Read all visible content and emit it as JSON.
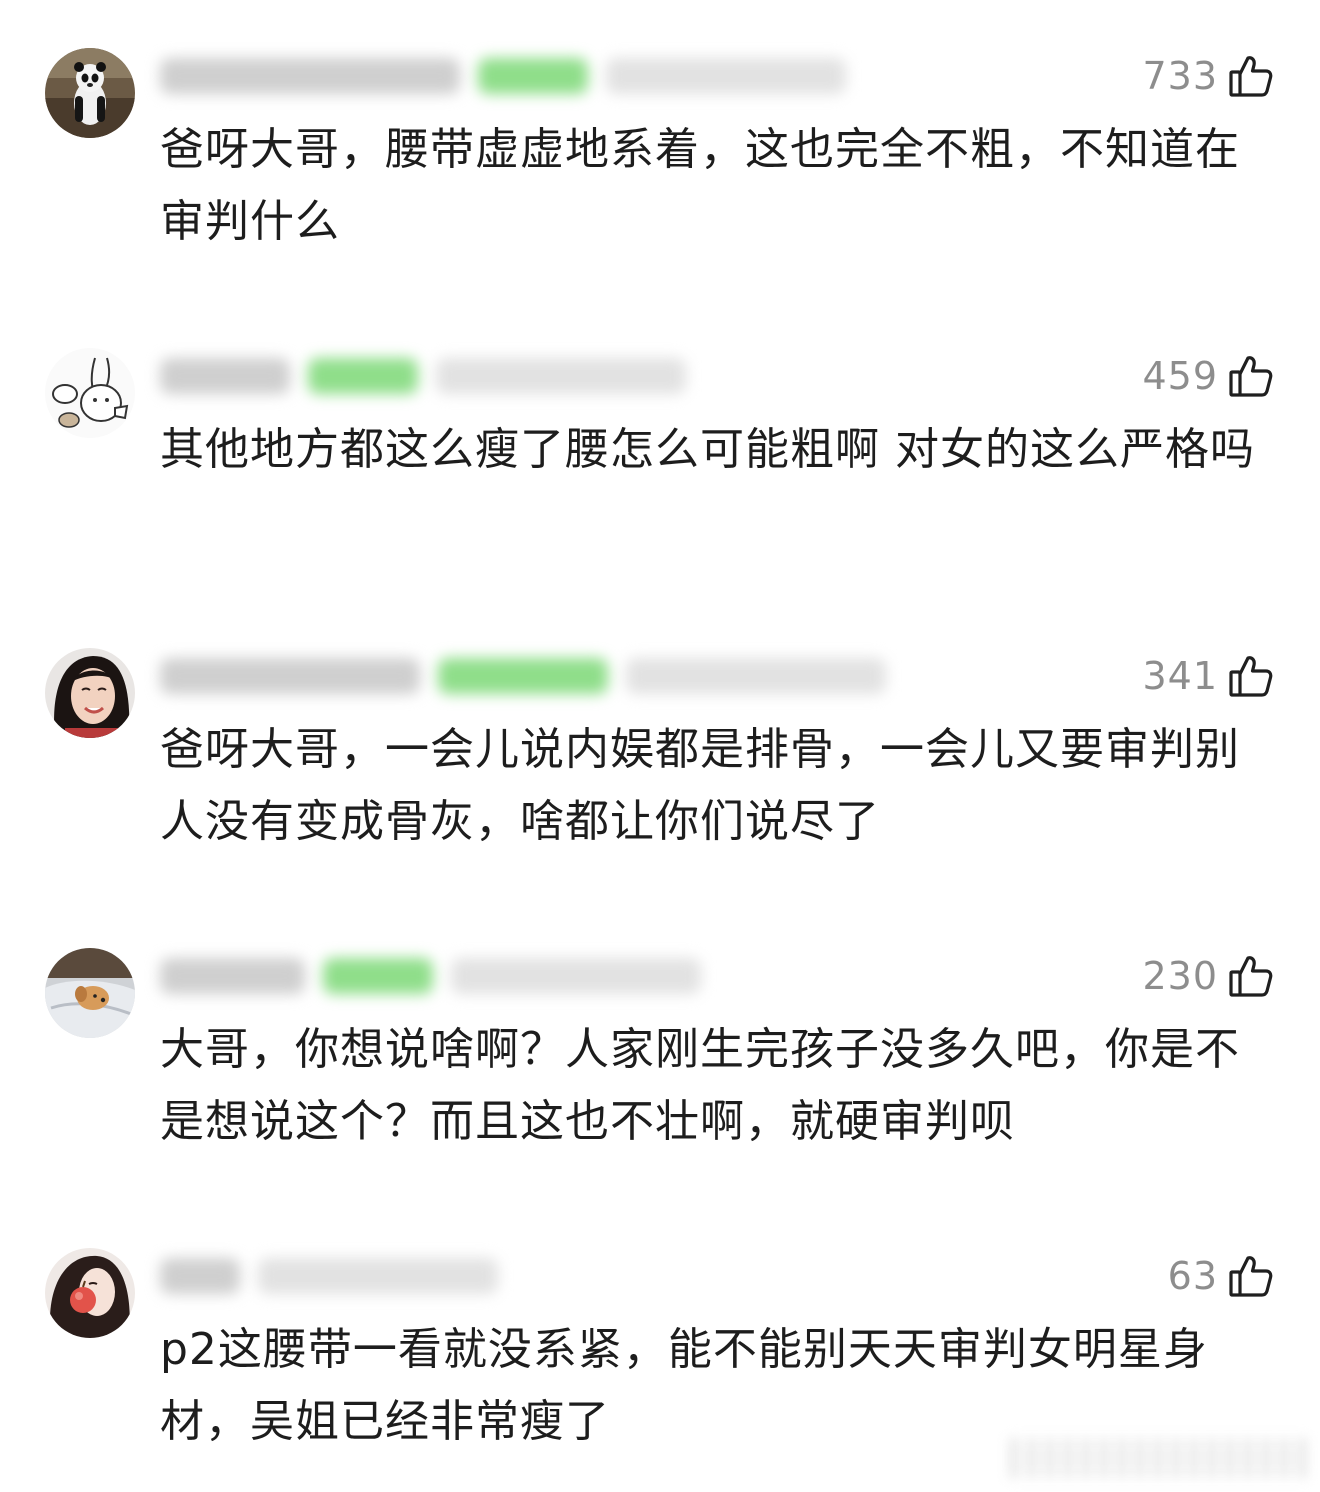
{
  "comments": [
    {
      "likes": "733",
      "text": "爸呀大哥，腰带虚虚地系着，这也完全不粗，不知道在审判什么",
      "avatar_icon": "panda-avatar-icon"
    },
    {
      "likes": "459",
      "text": "其他地方都这么瘦了腰怎么可能粗啊 对女的这么严格吗",
      "avatar_icon": "cartoon-rabbit-avatar-icon"
    },
    {
      "likes": "341",
      "text": "爸呀大哥，一会儿说内娱都是排骨，一会儿又要审判别人没有变成骨灰，啥都让你们说尽了",
      "avatar_icon": "smiling-woman-avatar-icon"
    },
    {
      "likes": "230",
      "text": "大哥，你想说啥啊？人家刚生完孩子没多久吧，你是不是想说这个？而且这也不壮啊，就硬审判呗",
      "avatar_icon": "dog-on-blanket-avatar-icon"
    },
    {
      "likes": "63",
      "text": "p2这腰带一看就没系紧，能不能别天天审判女明星身材，吴姐已经非常瘦了",
      "avatar_icon": "woman-with-apple-avatar-icon"
    }
  ],
  "like_icon": "thumbs-up-icon",
  "colors": {
    "text": "#1d1d1d",
    "like_count": "#8d8d8d",
    "blurred_badge": "#8fde8a",
    "background": "#ffffff"
  }
}
